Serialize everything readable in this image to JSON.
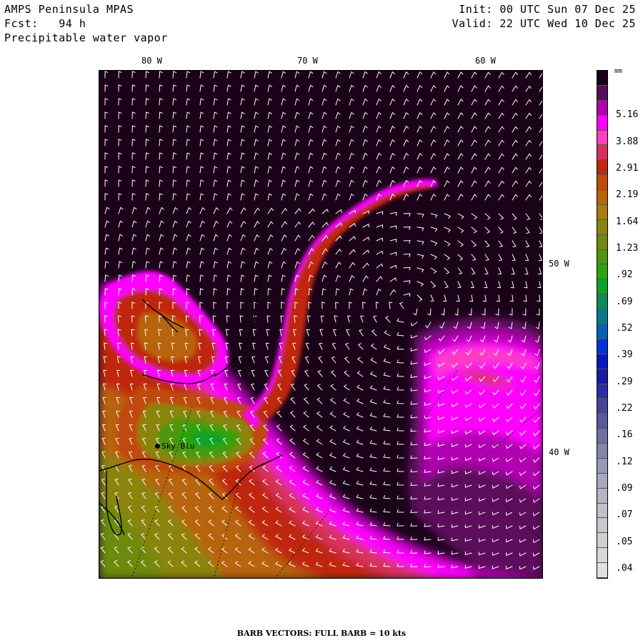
{
  "header": {
    "model": "AMPS Peninsula MPAS",
    "forecast_label": "Fcst:",
    "forecast_hours": "94 h",
    "field": "Precipitable water vapor",
    "init": "Init: 00 UTC Sun 07 Dec 25",
    "valid": "Valid: 22 UTC Wed 10 Dec 25"
  },
  "map": {
    "top_longitude_labels": [
      "80 W",
      "70 W",
      "60 W"
    ],
    "right_latitude_labels": [
      "50 W",
      "40 W"
    ],
    "station": "Sky Blu",
    "background_color": "#1a0318"
  },
  "colorbar": {
    "unit": "mm",
    "labels": [
      "5.16",
      "3.88",
      "2.91",
      "2.19",
      "1.64",
      "1.23",
      ".92",
      ".69",
      ".52",
      ".39",
      ".29",
      ".22",
      ".16",
      ".12",
      ".09",
      ".07",
      ".05",
      ".04"
    ],
    "colors": [
      "#1a0318",
      "#5c0a5c",
      "#b000b0",
      "#ff00ff",
      "#ff40c0",
      "#d8305c",
      "#c02810",
      "#c04a10",
      "#b86408",
      "#a87a10",
      "#8a8410",
      "#6e8a10",
      "#50960c",
      "#2aa40c",
      "#0aa22a",
      "#0c8a5a",
      "#0a7a88",
      "#0660b8",
      "#0432d8",
      "#0818c0",
      "#1a1aa8",
      "#2e2ea4",
      "#444498",
      "#5a5a98",
      "#7070a4",
      "#8484ac",
      "#9898b8",
      "#a8a8c0",
      "#b4b4c4",
      "#c0c0c8",
      "#c8c8cc",
      "#d0d0d2",
      "#d8d8d8",
      "#e0e0e0"
    ]
  },
  "footer": "BARB VECTORS:  FULL BARB = 10 kts"
}
